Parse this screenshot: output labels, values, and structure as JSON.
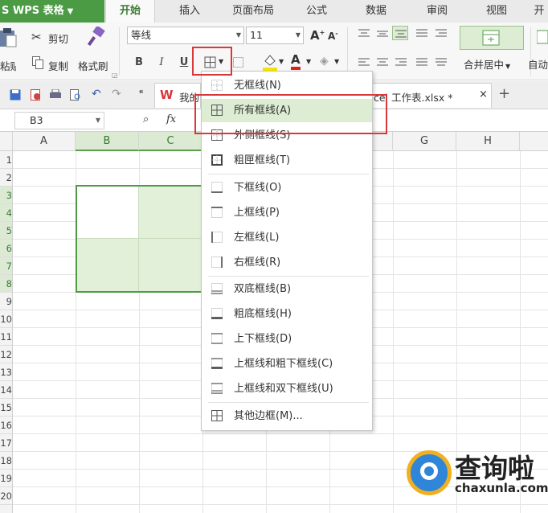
{
  "app": {
    "title": "WPS 表格",
    "title_prefix": "S"
  },
  "ribbon_tabs": [
    {
      "label": "开始",
      "active": true
    },
    {
      "label": "插入"
    },
    {
      "label": "页面布局"
    },
    {
      "label": "公式"
    },
    {
      "label": "数据"
    },
    {
      "label": "审阅"
    },
    {
      "label": "视图"
    },
    {
      "label": "开"
    }
  ],
  "clipboard": {
    "cut": "剪切",
    "paste": "粘贴",
    "copy": "复制",
    "format_painter": "格式刷"
  },
  "font": {
    "name": "等线",
    "size": "11",
    "bold": "B",
    "italic": "I",
    "underline": "U",
    "grow": "A",
    "shrink": "A"
  },
  "alignment": {
    "merge_center": "合并居中",
    "auto_wrap": "自动"
  },
  "doc_tabs": [
    {
      "label": "我的"
    },
    {
      "label": "cel 工作表.xlsx *"
    }
  ],
  "doc_tab_close": "×",
  "doc_tab_add": "+",
  "formula_bar": {
    "cell_ref": "B3",
    "fx": "fx"
  },
  "sheet": {
    "columns": [
      "A",
      "B",
      "C",
      "D",
      "E",
      "F",
      "G",
      "H"
    ],
    "rows": [
      "1",
      "2",
      "3",
      "4",
      "5",
      "6",
      "7",
      "8",
      "9",
      "10",
      "11",
      "12",
      "13",
      "14",
      "15",
      "16",
      "17",
      "18",
      "19",
      "20"
    ]
  },
  "border_menu": {
    "items": [
      {
        "label": "无框线(N)",
        "icon": "no-border-icon"
      },
      {
        "label": "所有框线(A)",
        "icon": "all-borders-icon",
        "highlighted": true
      },
      {
        "label": "外侧框线(S)",
        "icon": "outside-borders-icon"
      },
      {
        "label": "粗匣框线(T)",
        "icon": "thick-box-border-icon"
      },
      {
        "label": "下框线(O)",
        "icon": "bottom-border-icon"
      },
      {
        "label": "上框线(P)",
        "icon": "top-border-icon"
      },
      {
        "label": "左框线(L)",
        "icon": "left-border-icon"
      },
      {
        "label": "右框线(R)",
        "icon": "right-border-icon"
      },
      {
        "label": "双底框线(B)",
        "icon": "double-bottom-border-icon"
      },
      {
        "label": "粗底框线(H)",
        "icon": "thick-bottom-border-icon"
      },
      {
        "label": "上下框线(D)",
        "icon": "top-bottom-border-icon"
      },
      {
        "label": "上框线和粗下框线(C)",
        "icon": "top-thick-bottom-border-icon"
      },
      {
        "label": "上框线和双下框线(U)",
        "icon": "top-double-bottom-border-icon"
      },
      {
        "label": "其他边框(M)...",
        "icon": "more-borders-icon"
      }
    ]
  },
  "colors": {
    "accent": "#4b9a44",
    "highlight": "#dcedd3",
    "annotation": "#d9383a",
    "selection_fill": "#e2f0d9"
  },
  "watermark": {
    "title": "查询啦",
    "url": "chaxunla.com"
  }
}
